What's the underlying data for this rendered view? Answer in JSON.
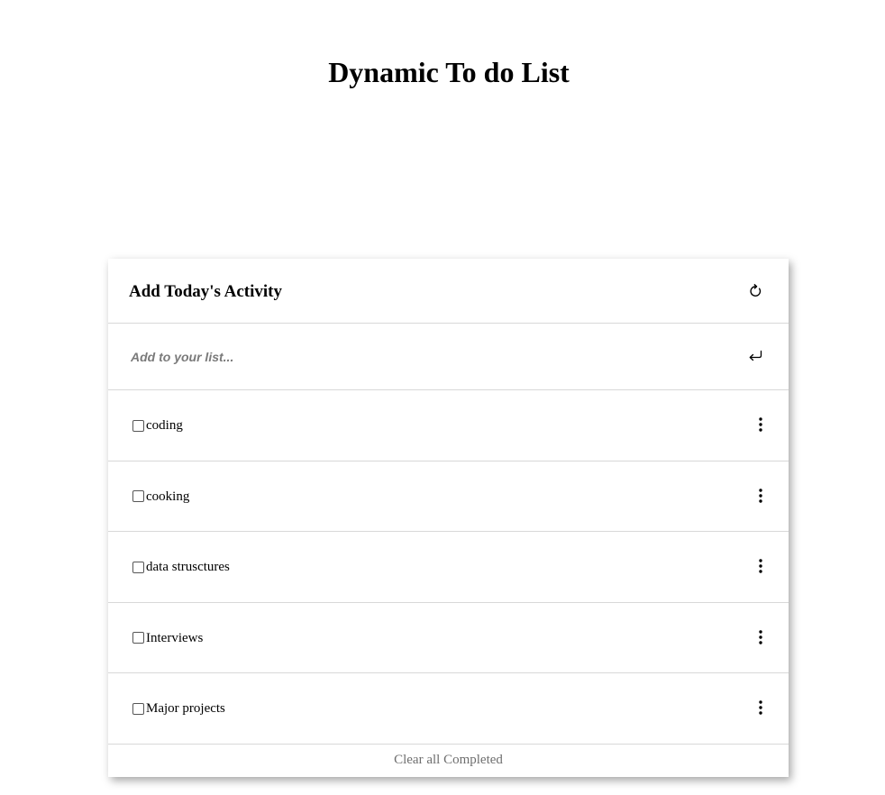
{
  "page": {
    "title": "Dynamic To do List"
  },
  "card": {
    "title": "Add Today's Activity",
    "refresh_icon": "refresh-icon"
  },
  "add_row": {
    "placeholder": "Add to your list...",
    "value": "",
    "enter_icon": "enter-icon"
  },
  "todos": [
    {
      "label": "coding",
      "checked": false
    },
    {
      "label": "cooking",
      "checked": false
    },
    {
      "label": "data strusctures",
      "checked": false
    },
    {
      "label": "Interviews",
      "checked": false
    },
    {
      "label": "Major projects",
      "checked": false
    }
  ],
  "footer": {
    "clear_label": "Clear all Completed"
  },
  "colors": {
    "divider": "#d8d8d8",
    "placeholder": "#7a7a7a",
    "footer_text": "#6e6e6e"
  }
}
